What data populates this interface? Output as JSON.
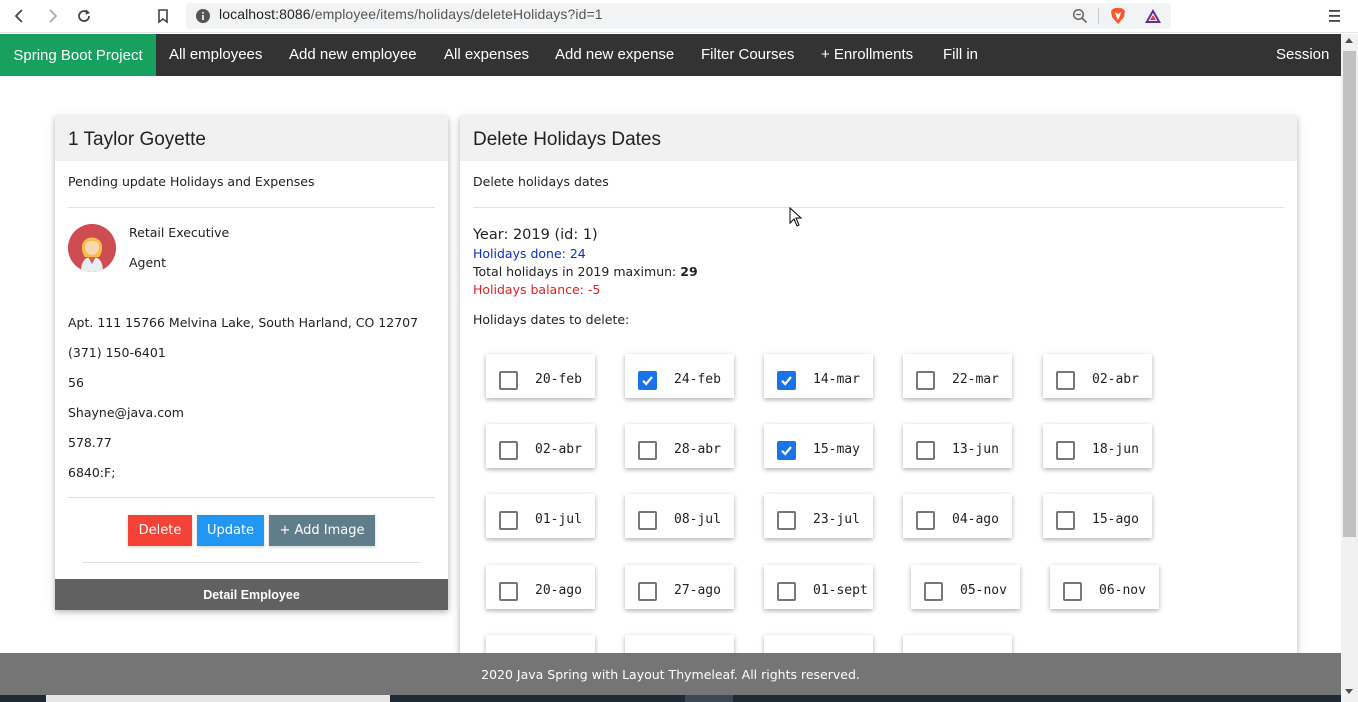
{
  "browser": {
    "url_host": "localhost:8086",
    "url_path": "/employee/items/holidays/deleteHolidays?id=1"
  },
  "navbar": {
    "brand": "Spring Boot Project",
    "items": [
      "All employees",
      "Add new employee",
      "All expenses",
      "Add new expense",
      "Filter Courses",
      "+ Enrollments",
      "Fill in"
    ],
    "session": "Session"
  },
  "employee_card": {
    "title": "1 Taylor Goyette",
    "subtitle": "Pending update Holidays and Expenses",
    "job_title": "Retail Executive",
    "role": "Agent",
    "address": "Apt. 111 15766 Melvina Lake, South Harland, CO 12707",
    "phone": "(371) 150-6401",
    "age": "56",
    "email": "Shayne@java.com",
    "salary": "578.77",
    "code": "6840:F;",
    "buttons": {
      "delete": "Delete",
      "update": "Update",
      "add_image": "+ Add Image"
    },
    "footer": "Detail Employee"
  },
  "holidays_card": {
    "title": "Delete Holidays Dates",
    "subtitle": "Delete holidays dates",
    "year_line": "Year: 2019 (id: 1)",
    "done_line": "Holidays done: 24",
    "max_prefix": "Total holidays in 2019 maximun:",
    "max_value": "29",
    "balance_line": "Holidays balance: -5",
    "list_label": "Holidays dates to delete:",
    "dates": [
      {
        "label": "20-feb",
        "checked": false
      },
      {
        "label": "24-feb",
        "checked": true
      },
      {
        "label": "14-mar",
        "checked": true
      },
      {
        "label": "22-mar",
        "checked": false
      },
      {
        "label": "02-abr",
        "checked": false
      },
      {
        "label": "02-abr",
        "checked": false
      },
      {
        "label": "28-abr",
        "checked": false
      },
      {
        "label": "15-may",
        "checked": true
      },
      {
        "label": "13-jun",
        "checked": false
      },
      {
        "label": "18-jun",
        "checked": false
      },
      {
        "label": "01-jul",
        "checked": false
      },
      {
        "label": "08-jul",
        "checked": false
      },
      {
        "label": "23-jul",
        "checked": false
      },
      {
        "label": "04-ago",
        "checked": false
      },
      {
        "label": "15-ago",
        "checked": false
      },
      {
        "label": "20-ago",
        "checked": false
      },
      {
        "label": "27-ago",
        "checked": false
      },
      {
        "label": "01-sept",
        "checked": false
      },
      {
        "label": "05-nov",
        "checked": false
      },
      {
        "label": "06-nov",
        "checked": false
      }
    ]
  },
  "footer": {
    "text": "2020 Java Spring with Layout Thymeleaf. All rights reserved."
  },
  "colors": {
    "brand_green": "#17a05e",
    "navbar_dark": "#333333",
    "delete_red": "#f44336",
    "update_blue": "#2196f3",
    "add_image_gray": "#607d8b",
    "done_blue": "#0b2fc7",
    "balance_red": "#e02020",
    "checkbox_blue": "#1a73e8"
  }
}
